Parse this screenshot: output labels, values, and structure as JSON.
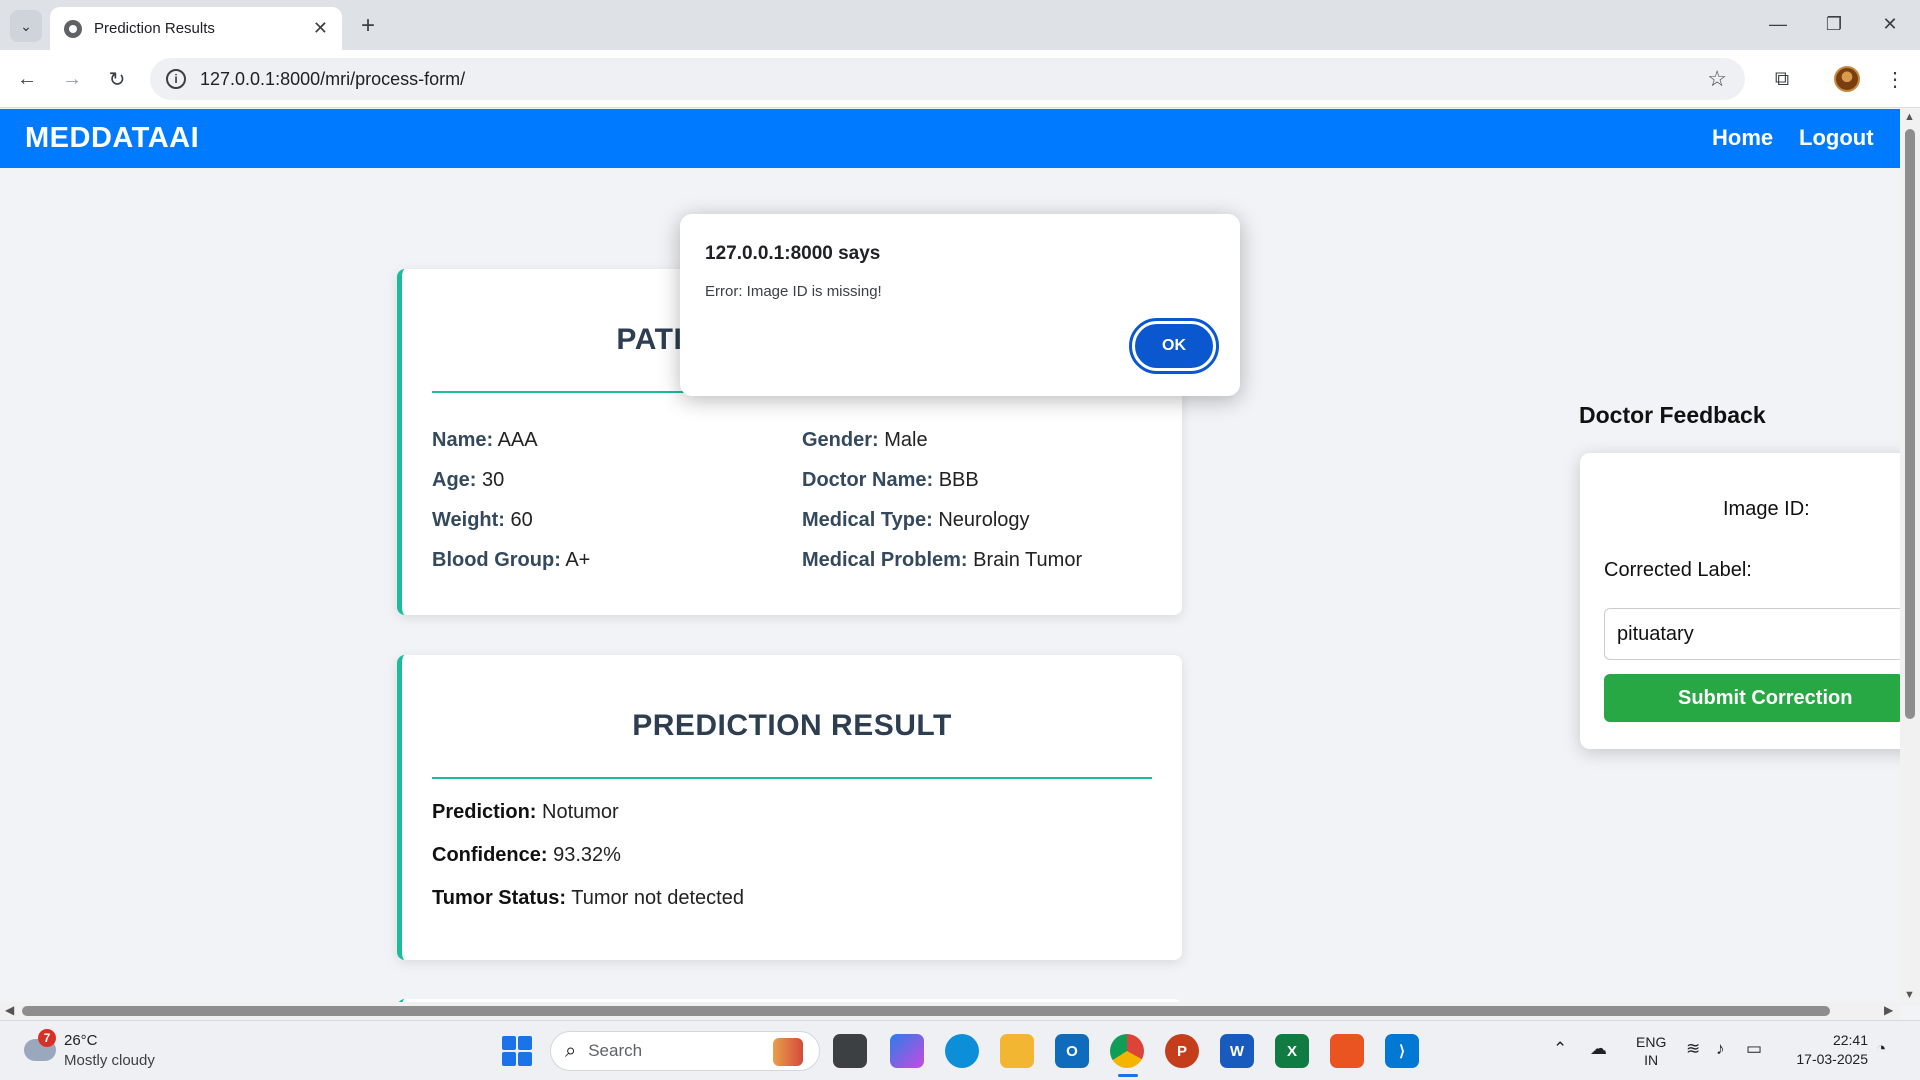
{
  "browser": {
    "tab_title": "Prediction Results",
    "url": "127.0.0.1:8000/mri/process-form/"
  },
  "nav": {
    "brand": "MEDDATAAI",
    "home": "Home",
    "logout": "Logout"
  },
  "patient": {
    "heading": "PATIENT INFORMATION",
    "fields": [
      {
        "label": "Name:",
        "value": "AAA"
      },
      {
        "label": "Age:",
        "value": "30"
      },
      {
        "label": "Weight:",
        "value": "60"
      },
      {
        "label": "Blood Group:",
        "value": "A+"
      },
      {
        "label": "Gender:",
        "value": "Male"
      },
      {
        "label": "Doctor Name:",
        "value": "BBB"
      },
      {
        "label": "Medical Type:",
        "value": "Neurology"
      },
      {
        "label": "Medical Problem:",
        "value": "Brain Tumor"
      }
    ]
  },
  "prediction": {
    "heading": "PREDICTION RESULT",
    "fields": [
      {
        "label": "Prediction:",
        "value": "Notumor"
      },
      {
        "label": "Confidence:",
        "value": "93.32%"
      },
      {
        "label": "Tumor Status:",
        "value": "Tumor not detected"
      }
    ]
  },
  "feedback": {
    "title": "Doctor Feedback",
    "image_id_label": "Image ID:",
    "corrected_label": "Corrected Label:",
    "input_value": "pituatary",
    "submit": "Submit Correction"
  },
  "dialog": {
    "title": "127.0.0.1:8000 says",
    "message": "Error: Image ID is missing!",
    "ok": "OK"
  },
  "taskbar": {
    "weather_badge": "7",
    "temperature": "26°C",
    "weather_desc": "Mostly cloudy",
    "search": "Search",
    "lang_1": "ENG",
    "lang_2": "IN",
    "time": "22:41",
    "date": "17-03-2025"
  },
  "colors": {
    "navbar": "#007bff",
    "accent_teal": "#1abc9c",
    "submit_green": "#28a745",
    "dialog_button": "#0b57d0"
  }
}
